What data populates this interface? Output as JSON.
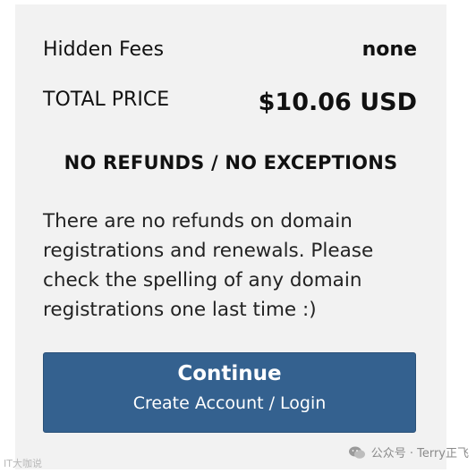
{
  "summary": {
    "hidden_fees_label": "Hidden Fees",
    "hidden_fees_value": "none",
    "total_label": "TOTAL PRICE",
    "total_value": "$10.06 USD"
  },
  "refund_policy": {
    "title": "NO REFUNDS / NO EXCEPTIONS",
    "text": "There are no refunds on domain registrations and renewals. Please check the spelling of any domain registrations one last time :)"
  },
  "continue_button": {
    "label": "Continue",
    "sublabel": "Create Account / Login"
  },
  "watermark": {
    "left_text": "IT大咖说",
    "right_text": "公众号 · Terry正飞",
    "icon": "wechat-icon"
  },
  "colors": {
    "panel_bg": "#f2f2f2",
    "button_bg": "#34618f"
  }
}
